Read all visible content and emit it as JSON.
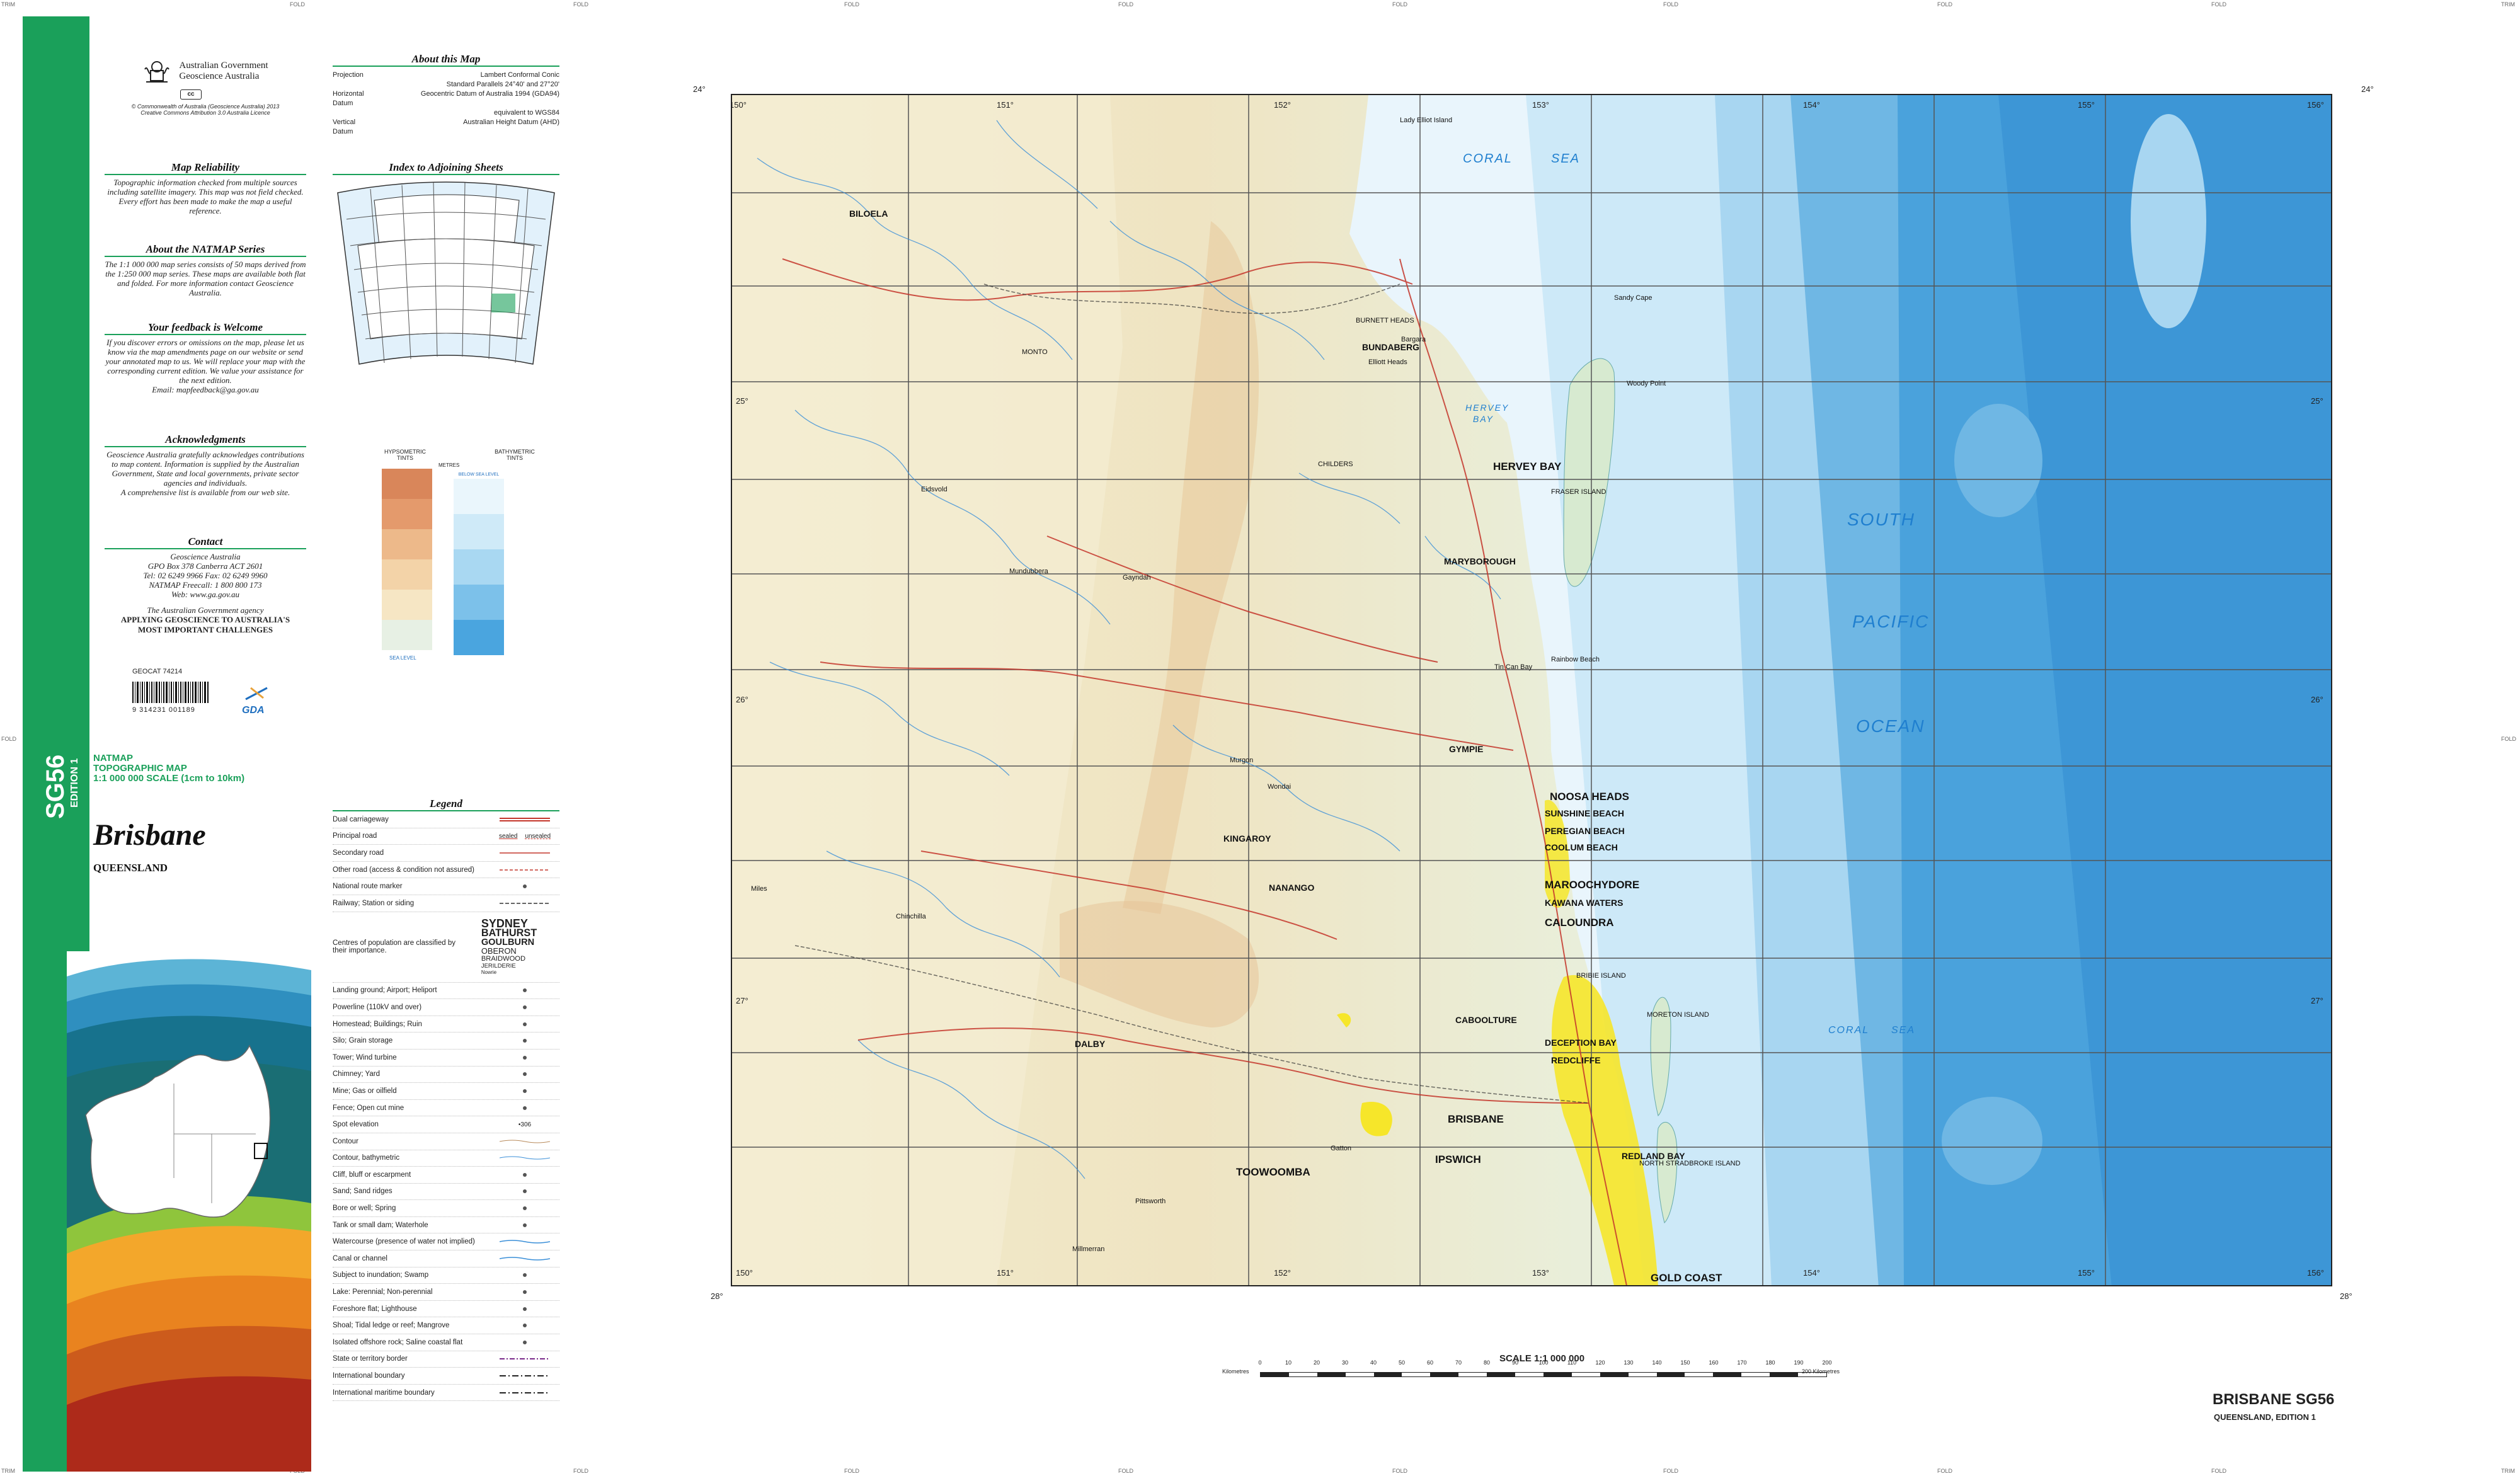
{
  "trim_marks": {
    "trim": "TRIM",
    "fold": "FOLD"
  },
  "sheet": {
    "code": "SG56",
    "edition": "EDITION 1",
    "series_line1": "NATMAP",
    "series_line2": "TOPOGRAPHIC MAP",
    "series_line3": "1:1 000 000 SCALE (1cm to 10km)",
    "title": "Brisbane",
    "state": "QUEENSLAND",
    "bottom_title": "BRISBANE SG56",
    "bottom_subtitle": "QUEENSLAND, EDITION 1",
    "accent": "#1aa05a"
  },
  "government": {
    "line1": "Australian Government",
    "line2": "Geoscience Australia",
    "copyright": "© Commonwealth of Australia (Geoscience Australia) 2013",
    "licence": "Creative Commons Attribution 3.0 Australia Licence"
  },
  "reliability": {
    "title": "Map Reliability",
    "text": "Topographic information checked from multiple sources including satellite imagery. This map was not field checked. Every effort has been made to make the map a useful reference."
  },
  "about_series": {
    "title": "About the NATMAP Series",
    "text": "The 1:1 000 000 map series consists of 50 maps derived from the 1:250 000 map series. These maps are available both flat and folded. For more information contact Geoscience Australia."
  },
  "feedback": {
    "title": "Your feedback is Welcome",
    "text": "If you discover errors or omissions on the map, please let us know via the map amendments page on our website or send your annotated map to us. We will replace your map with the corresponding current edition. We value your assistance for the next edition.",
    "email": "Email: mapfeedback@ga.gov.au"
  },
  "acknowledgments": {
    "title": "Acknowledgments",
    "text": "Geoscience Australia gratefully acknowledges contributions to map content. Information is supplied by the Australian Government, State and local governments, private sector agencies and individuals.",
    "text2": "A comprehensive list is available from our web site."
  },
  "contact": {
    "title": "Contact",
    "line1": "Geoscience Australia",
    "line2": "GPO Box 378 Canberra ACT 2601",
    "line3": "Tel: 02 6249 9966 Fax: 02 6249 9960",
    "line4": "NATMAP Freecall: 1 800 800 173",
    "line5": "Web: www.ga.gov.au",
    "motto1": "The Australian Government agency",
    "motto2": "APPLYING GEOSCIENCE TO AUSTRALIA'S",
    "motto3": "MOST IMPORTANT CHALLENGES"
  },
  "product": {
    "geocat": "GEOCAT 74214",
    "barcode_number": "9 314231 001189",
    "gda": "GDA"
  },
  "about_map": {
    "title": "About this Map",
    "rows": [
      {
        "k": "Projection",
        "v": "Lambert Conformal Conic"
      },
      {
        "k": "",
        "v": "Standard Parallels 24°40' and 27°20'"
      },
      {
        "k": "Horizontal Datum",
        "v": "Geocentric Datum of Australia 1994 (GDA94)"
      },
      {
        "k": "",
        "v": "equivalent to WGS84"
      },
      {
        "k": "Vertical Datum",
        "v": "Australian Height Datum (AHD)"
      }
    ]
  },
  "index_sheets": {
    "title": "Index to Adjoining Sheets"
  },
  "tints": {
    "hypsometric": "HYPSOMETRIC TINTS",
    "bathymetric": "BATHYMETRIC TINTS",
    "metres": "METRES",
    "sea_level": "SEA LEVEL",
    "below_sea": "BELOW SEA LEVEL",
    "hypso_colors": [
      "#d9865a",
      "#e49a6c",
      "#edb98a",
      "#f3d3a8",
      "#f6e6c4",
      "#e7f0e4"
    ],
    "bathy_colors": [
      "#eaf6fc",
      "#cfeaf8",
      "#a9d8f2",
      "#7cc1ea",
      "#4aa5df"
    ]
  },
  "legend": {
    "title": "Legend",
    "rows": [
      "Dual carriageway",
      "Principal road",
      "Secondary road",
      "Other road (access & condition not assured)",
      "National route marker",
      "Railway; Station or siding",
      "Centres of population are classified by their importance.",
      "Landing ground; Airport; Heliport",
      "Powerline (110kV and over)",
      "Homestead; Buildings; Ruin",
      "Silo; Grain storage",
      "Tower; Wind turbine",
      "Chimney; Yard",
      "Mine; Gas or oilfield",
      "Fence; Open cut mine",
      "Spot elevation",
      "Contour",
      "Contour, bathymetric",
      "Cliff, bluff or escarpment",
      "Sand; Sand ridges",
      "Bore or well; Spring",
      "Tank or small dam; Waterhole",
      "Watercourse (presence of water not implied)",
      "Canal or channel",
      "Subject to inundation; Swamp",
      "Lake: Perennial; Non-perennial",
      "Foreshore flat; Lighthouse",
      "Shoal; Tidal ledge or reef; Mangrove",
      "Isolated offshore rock; Saline coastal flat",
      "State or territory border",
      "International boundary",
      "International maritime boundary"
    ],
    "road_sealed": "sealed",
    "road_unsealed": "unsealed",
    "population": [
      "SYDNEY",
      "BATHURST",
      "GOULBURN",
      "OBERON",
      "BRAIDWOOD",
      "JERILDERIE",
      "Nowrie"
    ],
    "spot_elev": "•306"
  },
  "map": {
    "lon_labels": [
      "150°",
      "151°",
      "152°",
      "153°",
      "154°",
      "155°",
      "156°"
    ],
    "lat_labels": [
      "24°",
      "25°",
      "26°",
      "27°",
      "28°"
    ],
    "seas": [
      "CORAL",
      "SEA",
      "HERVEY",
      "BAY",
      "SOUTH",
      "PACIFIC",
      "OCEAN",
      "CORAL",
      "SEA"
    ],
    "places_major": [
      "BUNDABERG",
      "HERVEY BAY",
      "MARYBOROUGH",
      "GYMPIE",
      "NOOSA HEADS",
      "SUNSHINE BEACH",
      "PEREGIAN BEACH",
      "COOLUM BEACH",
      "MAROOCHYDORE",
      "KAWANA WATERS",
      "CALOUNDRA",
      "CABOOLTURE",
      "DECEPTION BAY",
      "REDCLIFFE",
      "BRISBANE",
      "IPSWICH",
      "TOOWOOMBA",
      "REDLAND BAY",
      "GOLD COAST",
      "KINGAROY",
      "NANANGO",
      "DALBY",
      "BILOELA",
      "MONTO",
      "CHILDERS",
      "BURNETT HEADS",
      "FRASER ISLAND",
      "MORETON ISLAND",
      "NORTH STRADBROKE ISLAND",
      "BRIBIE ISLAND"
    ],
    "places_minor": [
      "Lady Elliot Island",
      "Sandy Cape",
      "Rainbow Beach",
      "Tin Can Bay",
      "Elliott Heads",
      "Bargara",
      "Woody Point",
      "Gatton",
      "Pittsworth",
      "Millmerran",
      "Chinchilla",
      "Miles",
      "Wondai",
      "Murgon",
      "Gayndah",
      "Mundubbera",
      "Eidsvold"
    ]
  },
  "scale": {
    "title": "SCALE 1:1 000 000",
    "unit": "Kilometres",
    "ticks": [
      "0",
      "10",
      "20",
      "30",
      "40",
      "50",
      "60",
      "70",
      "80",
      "90",
      "100",
      "110",
      "120",
      "130",
      "140",
      "150",
      "160",
      "170",
      "180",
      "190",
      "200"
    ],
    "end_label": "200 Kilometres"
  }
}
